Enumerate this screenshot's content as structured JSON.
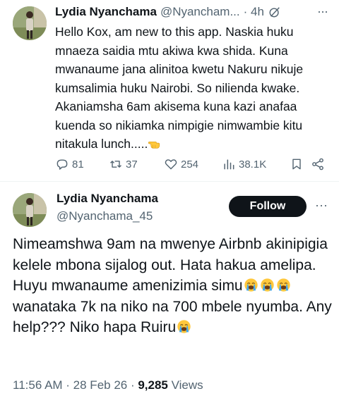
{
  "tweet1": {
    "author_name": "Lydia Nyanchama",
    "author_handle": "@Nyancham...",
    "time": "· 4h",
    "text_before_emoji": "Hello Kox, am new to this app. Naskia huku mnaeza saidia mtu akiwa kwa shida. Kuna mwanaume jana alinitoa kwetu Nakuru nikuje kumsalimia huku Nairobi. So nilienda kwake. Akaniamsha 6am akisema kuna kazi anafaa kuenda so nikiamka nimpigie nimwambie kitu nitakula lunch.....",
    "actions": {
      "replies": "81",
      "reposts": "37",
      "likes": "254",
      "views": "38.1K"
    },
    "icons": [
      "grok-icon",
      "more-icon",
      "reply-icon",
      "repost-icon",
      "like-icon",
      "views-icon",
      "bookmark-icon",
      "share-icon",
      "pointing-hand-emoji"
    ]
  },
  "tweet2": {
    "author_name": "Lydia Nyanchama",
    "author_handle": "@Nyanchama_45",
    "follow_label": "Follow",
    "text_part1": "Nimeamshwa 9am na mwenye Airbnb akinipigia kelele mbona sijalog out. Hata hakua amelipa. Huyu mwanaume amenizimia simu",
    "text_part2": "wanataka 7k na niko na 700 mbele nyumba. Any help??? Niko hapa Ruiru",
    "timestamp": "11:56 AM · 28 Feb 26 · ",
    "views_count": "9,285",
    "views_label": " Views",
    "icons": [
      "crying-emoji",
      "more-icon"
    ]
  },
  "colors": {
    "text_primary": "#0f1419",
    "text_secondary": "#536471",
    "follow_bg": "#0f1419",
    "emoji_yellow": "#ffc83d",
    "tear_blue": "#3ea6f2"
  }
}
